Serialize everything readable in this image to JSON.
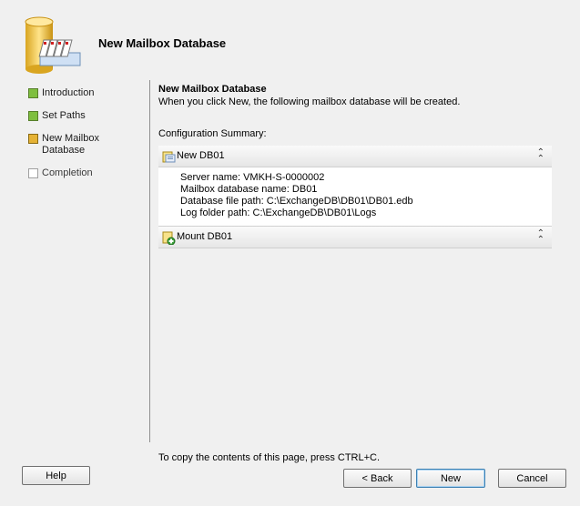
{
  "header": {
    "title": "New Mailbox Database"
  },
  "steps": [
    {
      "label": "Introduction",
      "state": "done"
    },
    {
      "label": "Set Paths",
      "state": "done"
    },
    {
      "label": "New Mailbox Database",
      "state": "current"
    },
    {
      "label": "Completion",
      "state": "pending"
    }
  ],
  "main": {
    "title": "New Mailbox Database",
    "description": "When you click New, the following mailbox database will be created.",
    "config_label": "Configuration Summary:",
    "sections": [
      {
        "title": "New DB01",
        "icon": "database-icon",
        "lines": [
          "Server name: VMKH-S-0000002",
          "Mailbox database name: DB01",
          "Database file path: C:\\ExchangeDB\\DB01\\DB01.edb",
          "Log folder path: C:\\ExchangeDB\\DB01\\Logs"
        ]
      },
      {
        "title": "Mount DB01",
        "icon": "mount-database-icon",
        "lines": []
      }
    ]
  },
  "footer": {
    "note": "To copy the contents of this page, press CTRL+C.",
    "help": "Help",
    "back": "< Back",
    "new": "New",
    "cancel": "Cancel"
  },
  "colors": {
    "done": "#7fbf3f",
    "current": "#e5b234",
    "pending": "#ffffff"
  }
}
